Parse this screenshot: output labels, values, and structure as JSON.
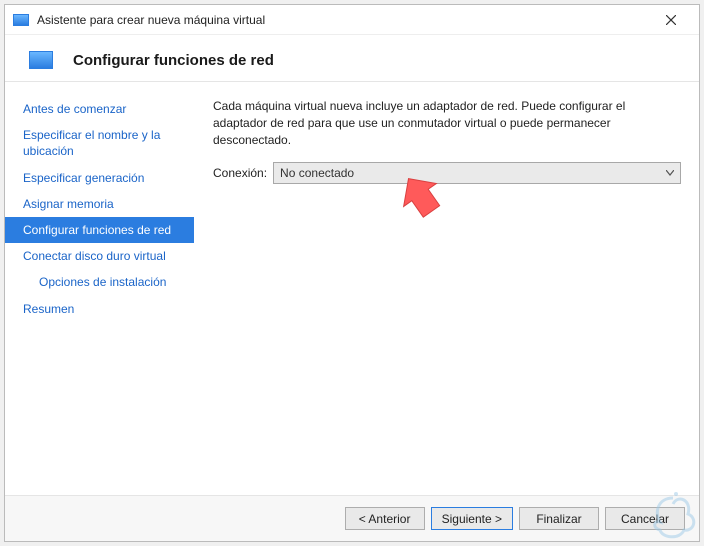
{
  "window": {
    "title": "Asistente para crear nueva máquina virtual"
  },
  "header": {
    "title": "Configurar funciones de red"
  },
  "sidebar": {
    "items": [
      {
        "label": "Antes de comenzar",
        "indent": false,
        "selected": false
      },
      {
        "label": "Especificar el nombre y la ubicación",
        "indent": false,
        "selected": false
      },
      {
        "label": "Especificar generación",
        "indent": false,
        "selected": false
      },
      {
        "label": "Asignar memoria",
        "indent": false,
        "selected": false
      },
      {
        "label": "Configurar funciones de red",
        "indent": false,
        "selected": true
      },
      {
        "label": "Conectar disco duro virtual",
        "indent": false,
        "selected": false
      },
      {
        "label": "Opciones de instalación",
        "indent": true,
        "selected": false
      },
      {
        "label": "Resumen",
        "indent": false,
        "selected": false
      }
    ]
  },
  "main": {
    "description": "Cada máquina virtual nueva incluye un adaptador de red. Puede configurar el adaptador de red para que use un conmutador virtual o puede permanecer desconectado.",
    "connection_label": "Conexión:",
    "connection_value": "No conectado"
  },
  "footer": {
    "previous": "< Anterior",
    "next": "Siguiente >",
    "finish": "Finalizar",
    "cancel": "Cancelar"
  }
}
